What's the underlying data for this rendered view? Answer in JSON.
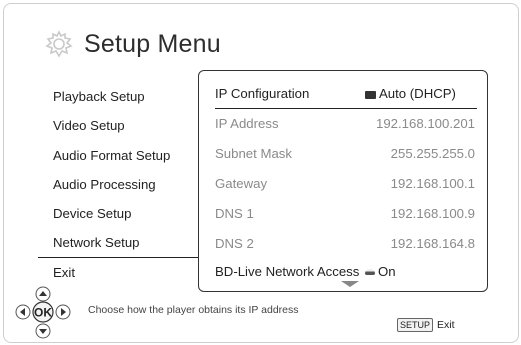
{
  "header": {
    "title": "Setup Menu",
    "icon": "gear-icon"
  },
  "menu": {
    "items": [
      {
        "label": "Playback Setup"
      },
      {
        "label": "Video Setup"
      },
      {
        "label": "Audio Format Setup"
      },
      {
        "label": "Audio Processing"
      },
      {
        "label": "Device Setup"
      },
      {
        "label": "Network Setup",
        "selected": true
      },
      {
        "label": "Exit"
      }
    ]
  },
  "panel": {
    "rows": [
      {
        "label": "IP Configuration",
        "value": "Auto (DHCP)",
        "icon": "dropdown-icon",
        "active": true
      },
      {
        "label": "IP Address",
        "value": "192.168.100.201",
        "disabled": true
      },
      {
        "label": "Subnet Mask",
        "value": "255.255.255.0",
        "disabled": true
      },
      {
        "label": "Gateway",
        "value": "192.168.100.1",
        "disabled": true
      },
      {
        "label": "DNS 1",
        "value": "192.168.100.9",
        "disabled": true
      },
      {
        "label": "DNS 2",
        "value": "192.168.164.8",
        "disabled": true
      },
      {
        "label": "BD-Live Network Access",
        "value": "On",
        "icon": "toggle-icon"
      }
    ]
  },
  "footer": {
    "nav_center": "OK",
    "hint": "Choose how the player obtains its IP address",
    "setup_key": "SETUP",
    "setup_action": "Exit"
  }
}
